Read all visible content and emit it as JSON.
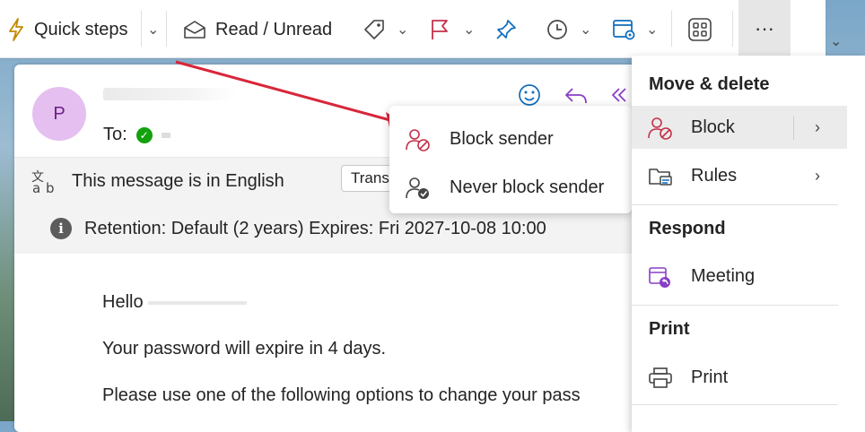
{
  "toolbar": {
    "quick_steps_label": "Quick steps",
    "read_unread_label": "Read / Unread",
    "overflow_glyph": "···"
  },
  "message": {
    "avatar_initial": "P",
    "to_label": "To:",
    "language_notice": "This message is in English",
    "translate_label": "Translate",
    "retention_text": "Retention: Default (2 years) Expires: Fri 2027-10-08 10:00",
    "body": {
      "greeting": "Hello",
      "line1": "Your password will expire in 4 days.",
      "line2": "Please use one of the following options to change your pass"
    }
  },
  "context_menu": {
    "items": [
      {
        "label": "Block sender",
        "icon": "block-person-icon"
      },
      {
        "label": "Never block sender",
        "icon": "person-check-icon"
      }
    ]
  },
  "overflow_menu": {
    "sections": [
      {
        "title": "Move & delete",
        "items": [
          {
            "label": "Block",
            "icon": "block-person-icon",
            "has_submenu": true,
            "active": true
          },
          {
            "label": "Rules",
            "icon": "rules-folder-icon",
            "has_submenu": true
          }
        ]
      },
      {
        "title": "Respond",
        "items": [
          {
            "label": "Meeting",
            "icon": "calendar-reply-icon"
          }
        ]
      },
      {
        "title": "Print",
        "items": [
          {
            "label": "Print",
            "icon": "printer-icon"
          }
        ]
      }
    ]
  },
  "colors": {
    "accent_blue": "#0f6cbd",
    "block_red": "#c4314b",
    "reply_purple": "#8a3fc7",
    "annotation_arrow": "#d9263a",
    "avatar_bg": "#e5bff0"
  }
}
